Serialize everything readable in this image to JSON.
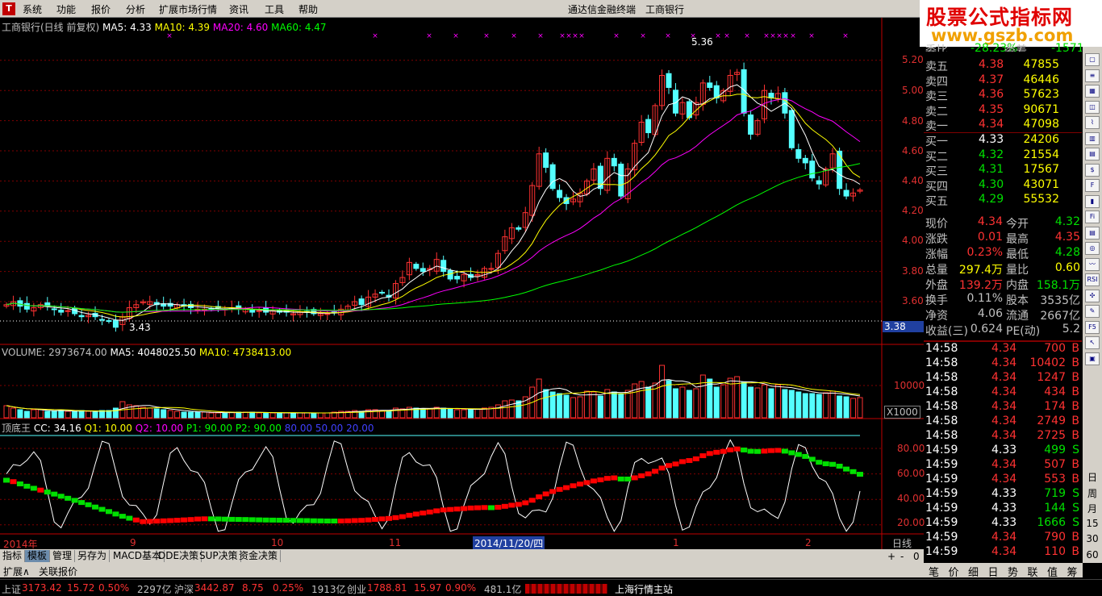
{
  "menubar": {
    "items": [
      "系统",
      "功能",
      "报价",
      "分析",
      "扩展市场行情",
      "资讯",
      "工具",
      "帮助"
    ],
    "app_title": "通达信金融终端",
    "stock_title": "工商银行"
  },
  "watermark": {
    "line1": "股票公式指标网",
    "line2": "www.gszb.com"
  },
  "price_panel": {
    "title": "工商银行(日线 前复权)",
    "ma5": "MA5: 4.33",
    "ma10": "MA10: 4.39",
    "ma20": "MA20: 4.60",
    "ma60": "MA60: 4.47",
    "y_ticks": [
      "5.20",
      "5.00",
      "4.80",
      "4.60",
      "4.40",
      "4.20",
      "4.00",
      "3.80",
      "3.60"
    ],
    "high_label": "5.36",
    "low_label": "3.43",
    "cursor_price": "3.38"
  },
  "volume_panel": {
    "title": "VOLUME: 2973674.00",
    "ma5": "MA5: 4048025.50",
    "ma10": "MA10: 4738413.00",
    "y_tick": "10000",
    "unit": "X1000"
  },
  "indicator_panel": {
    "name": "顶底王",
    "cc": "CC: 34.16",
    "q1": "Q1: 10.00",
    "q2": "Q2: 10.00",
    "p1": "P1: 90.00",
    "p2": "P2: 90.00",
    "l80": "80.00",
    "l50": "50.00",
    "l20": "20.00",
    "y_ticks": [
      "80.00",
      "60.00",
      "40.00",
      "20.00"
    ]
  },
  "time_axis": {
    "labels": [
      "2014年",
      "9",
      "10",
      "11",
      "1",
      "2"
    ],
    "cursor_date": "2014/11/20/四",
    "period": "日线",
    "zoom_buttons": [
      "+",
      "-",
      "0"
    ]
  },
  "tabs": [
    "指标",
    "模板",
    "管理",
    "另存为",
    "MACD基本",
    "DDE决策",
    "SUP决策",
    "资金决策"
  ],
  "ext_bar": [
    "扩展∧",
    "关联报价"
  ],
  "order_book": {
    "header": {
      "left": "委比",
      "left_val": "-28.23%",
      "right": "委差",
      "right_val": "-1571"
    },
    "asks": [
      {
        "label": "卖五",
        "price": "4.38",
        "vol": "47855"
      },
      {
        "label": "卖四",
        "price": "4.37",
        "vol": "46446"
      },
      {
        "label": "卖三",
        "price": "4.36",
        "vol": "57623"
      },
      {
        "label": "卖二",
        "price": "4.35",
        "vol": "90671"
      },
      {
        "label": "卖一",
        "price": "4.34",
        "vol": "47098"
      }
    ],
    "bids": [
      {
        "label": "买一",
        "price": "4.33",
        "vol": "24206"
      },
      {
        "label": "买二",
        "price": "4.32",
        "vol": "21554"
      },
      {
        "label": "买三",
        "price": "4.31",
        "vol": "17567"
      },
      {
        "label": "买四",
        "price": "4.30",
        "vol": "43071"
      },
      {
        "label": "买五",
        "price": "4.29",
        "vol": "55532"
      }
    ]
  },
  "stats": [
    {
      "l1": "现价",
      "v1": "4.34",
      "l2": "今开",
      "v2": "4.32"
    },
    {
      "l1": "涨跌",
      "v1": "0.01",
      "l2": "最高",
      "v2": "4.35"
    },
    {
      "l1": "涨幅",
      "v1": "0.23%",
      "l2": "最低",
      "v2": "4.28"
    },
    {
      "l1": "总量",
      "v1": "297.4万",
      "l2": "量比",
      "v2": "0.60"
    },
    {
      "l1": "外盘",
      "v1": "139.2万",
      "l2": "内盘",
      "v2": "158.1万"
    },
    {
      "l1": "换手",
      "v1": "0.11%",
      "l2": "股本",
      "v2": "3535亿"
    },
    {
      "l1": "净资",
      "v1": "4.06",
      "l2": "流通",
      "v2": "2667亿"
    },
    {
      "l1": "收益(三)",
      "v1": "0.624",
      "l2": "PE(动)",
      "v2": "5.2"
    }
  ],
  "trades": [
    {
      "time": "14:58",
      "price": "4.34",
      "vol": "700",
      "side": "B"
    },
    {
      "time": "14:58",
      "price": "4.34",
      "vol": "10402",
      "side": "B"
    },
    {
      "time": "14:58",
      "price": "4.34",
      "vol": "1247",
      "side": "B"
    },
    {
      "time": "14:58",
      "price": "4.34",
      "vol": "434",
      "side": "B"
    },
    {
      "time": "14:58",
      "price": "4.34",
      "vol": "174",
      "side": "B"
    },
    {
      "time": "14:58",
      "price": "4.34",
      "vol": "2749",
      "side": "B"
    },
    {
      "time": "14:58",
      "price": "4.34",
      "vol": "2725",
      "side": "B"
    },
    {
      "time": "14:59",
      "price": "4.33",
      "vol": "499",
      "side": "S"
    },
    {
      "time": "14:59",
      "price": "4.34",
      "vol": "507",
      "side": "B"
    },
    {
      "time": "14:59",
      "price": "4.34",
      "vol": "553",
      "side": "B"
    },
    {
      "time": "14:59",
      "price": "4.33",
      "vol": "719",
      "side": "S"
    },
    {
      "time": "14:59",
      "price": "4.33",
      "vol": "144",
      "side": "S"
    },
    {
      "time": "14:59",
      "price": "4.33",
      "vol": "1666",
      "side": "S"
    },
    {
      "time": "14:59",
      "price": "4.34",
      "vol": "790",
      "side": "B"
    },
    {
      "time": "14:59",
      "price": "4.34",
      "vol": "110",
      "side": "B"
    }
  ],
  "bottom_tabs": [
    "笔",
    "价",
    "细",
    "日",
    "势",
    "联",
    "值",
    "筹"
  ],
  "tool_labels": [
    "日",
    "周",
    "月",
    "15",
    "30",
    "60"
  ],
  "status": {
    "sh_label": "上证",
    "sh_val": "3173.42",
    "sh_chg": "15.72",
    "sh_pct": "0.50%",
    "sh_amt": "2297亿",
    "sz_label": "沪深",
    "sz_val": "3442.87",
    "sz_chg": "8.75",
    "sz_pct": "0.25%",
    "sz_amt": "1913亿",
    "cy_label": "创业",
    "cy_val": "1788.81",
    "cy_chg": "15.97",
    "cy_pct": "0.90%",
    "cy_amt": "481.1亿",
    "station": "上海行情主站"
  },
  "colors": {
    "up": "#ff3232",
    "down": "#54ffff",
    "ma5": "#ffffff",
    "ma10": "#ffff00",
    "ma20": "#ff00ff",
    "ma60": "#00ff00",
    "grid": "#800000"
  },
  "chart_data": {
    "type": "candlestick",
    "closes": [
      3.58,
      3.6,
      3.57,
      3.55,
      3.56,
      3.58,
      3.57,
      3.55,
      3.53,
      3.54,
      3.52,
      3.5,
      3.51,
      3.5,
      3.48,
      3.47,
      3.43,
      3.5,
      3.56,
      3.58,
      3.6,
      3.6,
      3.58,
      3.57,
      3.57,
      3.58,
      3.57,
      3.56,
      3.55,
      3.55,
      3.55,
      3.56,
      3.55,
      3.56,
      3.55,
      3.55,
      3.53,
      3.54,
      3.53,
      3.54,
      3.53,
      3.53,
      3.52,
      3.53,
      3.53,
      3.52,
      3.52,
      3.52,
      3.53,
      3.55,
      3.57,
      3.6,
      3.58,
      3.63,
      3.65,
      3.66,
      3.63,
      3.72,
      3.76,
      3.86,
      3.82,
      3.8,
      3.82,
      3.88,
      3.8,
      3.75,
      3.75,
      3.78,
      3.76,
      3.78,
      3.82,
      3.82,
      3.92,
      4.03,
      4.09,
      4.08,
      4.19,
      4.37,
      4.58,
      4.49,
      4.35,
      4.29,
      4.25,
      4.28,
      4.32,
      4.4,
      4.48,
      4.35,
      4.55,
      4.5,
      4.3,
      4.48,
      4.65,
      4.79,
      4.72,
      4.9,
      5.1,
      5.02,
      4.85,
      4.92,
      4.82,
      4.92,
      5.05,
      5.02,
      4.95,
      5.0,
      5.1,
      5.12,
      4.85,
      4.71,
      4.8,
      5.0,
      4.95,
      4.98,
      4.85,
      4.62,
      4.55,
      4.52,
      4.42,
      4.38,
      4.48,
      4.58,
      4.35,
      4.3,
      4.32,
      4.34
    ],
    "volumes": [
      1.5,
      1.2,
      1.0,
      0.8,
      1.0,
      1.0,
      0.8,
      0.8,
      0.9,
      0.8,
      0.8,
      0.9,
      0.8,
      0.7,
      0.9,
      0.9,
      1.2,
      2.0,
      1.6,
      1.5,
      1.3,
      1.2,
      1.1,
      1.0,
      0.9,
      0.8,
      0.7,
      0.7,
      0.7,
      0.7,
      0.6,
      0.6,
      0.6,
      0.7,
      0.7,
      0.7,
      0.7,
      0.6,
      0.6,
      0.6,
      0.6,
      0.6,
      0.6,
      0.6,
      0.6,
      0.6,
      0.6,
      0.6,
      0.7,
      0.8,
      0.8,
      0.9,
      0.8,
      1.0,
      1.0,
      0.9,
      0.9,
      1.2,
      1.1,
      1.3,
      1.2,
      1.1,
      1.1,
      1.3,
      1.2,
      1.1,
      1.0,
      1.0,
      1.0,
      1.1,
      1.2,
      1.3,
      1.6,
      2.1,
      2.2,
      2.1,
      2.6,
      3.8,
      4.8,
      3.5,
      3.2,
      3.0,
      2.8,
      2.5,
      2.6,
      3.3,
      3.2,
      2.7,
      3.5,
      3.2,
      3.0,
      3.4,
      4.2,
      4.5,
      3.8,
      4.3,
      6.5,
      4.6,
      3.6,
      3.8,
      3.4,
      3.6,
      5.3,
      4.8,
      3.8,
      4.1,
      4.9,
      5.1,
      4.4,
      3.8,
      3.7,
      4.1,
      3.6,
      4.1,
      3.5,
      3.4,
      3.2,
      3.0,
      3.0,
      2.9,
      3.1,
      3.3,
      2.7,
      2.6,
      2.4,
      2.5
    ]
  }
}
